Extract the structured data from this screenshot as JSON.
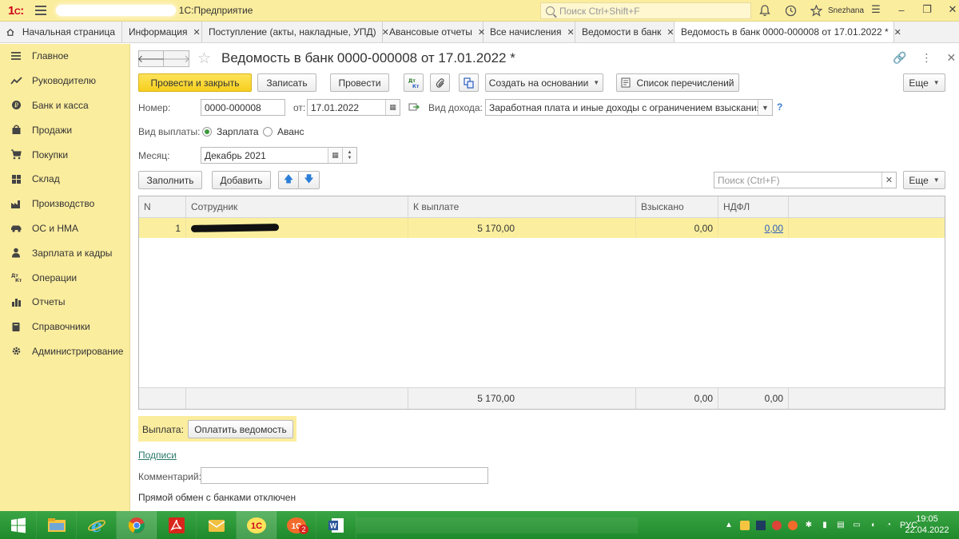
{
  "window": {
    "app_title": "1С:Предприятие",
    "search_placeholder": "Поиск Ctrl+Shift+F",
    "username": "Snezhana"
  },
  "tabs": [
    {
      "label": "Начальная страница",
      "closable": false
    },
    {
      "label": "Информация",
      "closable": true
    },
    {
      "label": "Поступление (акты, накладные, УПД)",
      "closable": true
    },
    {
      "label": "Авансовые отчеты",
      "closable": true
    },
    {
      "label": "Все начисления",
      "closable": true
    },
    {
      "label": "Ведомости в банк",
      "closable": true
    },
    {
      "label": "Ведомость в банк 0000-000008 от 17.01.2022 *",
      "closable": true,
      "active": true
    }
  ],
  "sidebar": {
    "items": [
      {
        "label": "Главное",
        "icon": "menu-lines-icon"
      },
      {
        "label": "Руководителю",
        "icon": "trend-chart-icon"
      },
      {
        "label": "Банк и касса",
        "icon": "coin-icon"
      },
      {
        "label": "Продажи",
        "icon": "bag-icon"
      },
      {
        "label": "Покупки",
        "icon": "cart-icon"
      },
      {
        "label": "Склад",
        "icon": "warehouse-icon"
      },
      {
        "label": "Производство",
        "icon": "factory-icon"
      },
      {
        "label": "ОС и НМА",
        "icon": "car-icon"
      },
      {
        "label": "Зарплата и кадры",
        "icon": "person-icon"
      },
      {
        "label": "Операции",
        "icon": "debit-credit-icon"
      },
      {
        "label": "Отчеты",
        "icon": "bar-chart-icon"
      },
      {
        "label": "Справочники",
        "icon": "book-icon"
      },
      {
        "label": "Администрирование",
        "icon": "gear-icon"
      }
    ]
  },
  "form": {
    "title": "Ведомость в банк 0000-000008 от 17.01.2022 *",
    "toolbar": {
      "post_and_close": "Провести и закрыть",
      "save": "Записать",
      "post": "Провести",
      "create_based_on": "Создать на основании",
      "transfer_list": "Список перечислений",
      "more": "Еще"
    },
    "number_label": "Номер:",
    "number_value": "0000-000008",
    "date_label": "от:",
    "date_value": "17.01.2022",
    "income_type_label": "Вид дохода:",
    "income_type_value": "Заработная плата и иные доходы с ограничением взыскания",
    "help": "?",
    "payment_type_label": "Вид выплаты:",
    "payment_options": [
      "Зарплата",
      "Аванс"
    ],
    "payment_selected": "Зарплата",
    "month_label": "Месяц:",
    "month_value": "Декабрь 2021",
    "fill_button": "Заполнить",
    "add_button": "Добавить",
    "table_search_placeholder": "Поиск (Ctrl+F)",
    "table_more": "Еще"
  },
  "table": {
    "columns": [
      "N",
      "Сотрудник",
      "К выплате",
      "Взыскано",
      "НДФЛ"
    ],
    "rows": [
      {
        "n": "1",
        "employee": "",
        "to_pay": "5 170,00",
        "collected": "",
        "ndfl_withheld": "0,00",
        "ndfl": "0,00"
      }
    ],
    "totals": {
      "to_pay": "5 170,00",
      "collected": "0,00",
      "ndfl": "0,00"
    }
  },
  "footer": {
    "payment_label": "Выплата:",
    "pay_statement_button": "Оплатить ведомость",
    "signatures_link": "Подписи",
    "comment_label": "Комментарий:",
    "comment_value": "",
    "bank_exchange_status": "Прямой обмен с банками отключен"
  },
  "taskbar": {
    "time": "19:05",
    "date": "22.04.2022",
    "lang": "РУС",
    "notification_badge": "2"
  },
  "colors": {
    "accent_yellow": "#fbed9e",
    "primary_button": "#f6cf1d",
    "taskbar_green": "#2a9a36",
    "link_blue": "#2b5ebf"
  }
}
